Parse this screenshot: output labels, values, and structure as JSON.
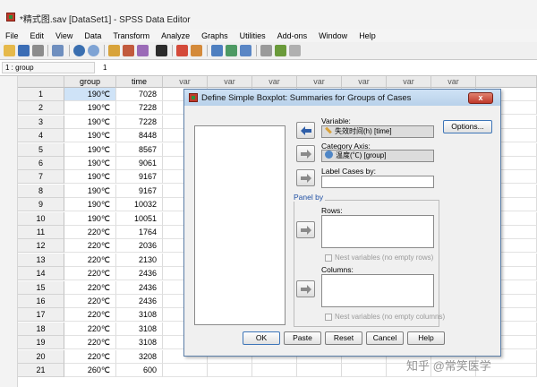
{
  "window": {
    "title": "*精式图.sav [DataSet1] - SPSS Data Editor"
  },
  "menu": [
    "File",
    "Edit",
    "View",
    "Data",
    "Transform",
    "Analyze",
    "Graphs",
    "Utilities",
    "Add-ons",
    "Window",
    "Help"
  ],
  "cellbar": {
    "ref": "1 : group",
    "value": "1"
  },
  "grid": {
    "columns": [
      "group",
      "time",
      "var",
      "var",
      "var",
      "var",
      "var",
      "var",
      "var"
    ],
    "rows": [
      {
        "n": "1",
        "group": "190℃",
        "time": "7028"
      },
      {
        "n": "2",
        "group": "190℃",
        "time": "7228"
      },
      {
        "n": "3",
        "group": "190℃",
        "time": "7228"
      },
      {
        "n": "4",
        "group": "190℃",
        "time": "8448"
      },
      {
        "n": "5",
        "group": "190℃",
        "time": "8567"
      },
      {
        "n": "6",
        "group": "190℃",
        "time": "9061"
      },
      {
        "n": "7",
        "group": "190℃",
        "time": "9167"
      },
      {
        "n": "8",
        "group": "190℃",
        "time": "9167"
      },
      {
        "n": "9",
        "group": "190℃",
        "time": "10032"
      },
      {
        "n": "10",
        "group": "190℃",
        "time": "10051"
      },
      {
        "n": "11",
        "group": "220℃",
        "time": "1764"
      },
      {
        "n": "12",
        "group": "220℃",
        "time": "2036"
      },
      {
        "n": "13",
        "group": "220℃",
        "time": "2130"
      },
      {
        "n": "14",
        "group": "220℃",
        "time": "2436"
      },
      {
        "n": "15",
        "group": "220℃",
        "time": "2436"
      },
      {
        "n": "16",
        "group": "220℃",
        "time": "2436"
      },
      {
        "n": "17",
        "group": "220℃",
        "time": "3108"
      },
      {
        "n": "18",
        "group": "220℃",
        "time": "3108"
      },
      {
        "n": "19",
        "group": "220℃",
        "time": "3108"
      },
      {
        "n": "20",
        "group": "220℃",
        "time": "3208"
      },
      {
        "n": "21",
        "group": "260℃",
        "time": "600"
      }
    ]
  },
  "dialog": {
    "title": "Define Simple Boxplot: Summaries for Groups of Cases",
    "close": "x",
    "variable_label": "Variable:",
    "variable_value": "失效时间(h) [time]",
    "category_label": "Category Axis:",
    "category_value": "温度(℃) [group]",
    "label_cases_label": "Label Cases by:",
    "panel_legend": "Panel by",
    "rows_label": "Rows:",
    "rows_nest": "Nest variables (no empty rows)",
    "columns_label": "Columns:",
    "columns_nest": "Nest variables (no empty columns)",
    "options_button": "Options...",
    "buttons": {
      "ok": "OK",
      "paste": "Paste",
      "reset": "Reset",
      "cancel": "Cancel",
      "help": "Help"
    }
  },
  "watermark": "知乎 @常笑医学",
  "colors": {
    "selection": "#cfe3f7",
    "dialog_accent": "#1f4fa3",
    "close": "#c0392b"
  }
}
